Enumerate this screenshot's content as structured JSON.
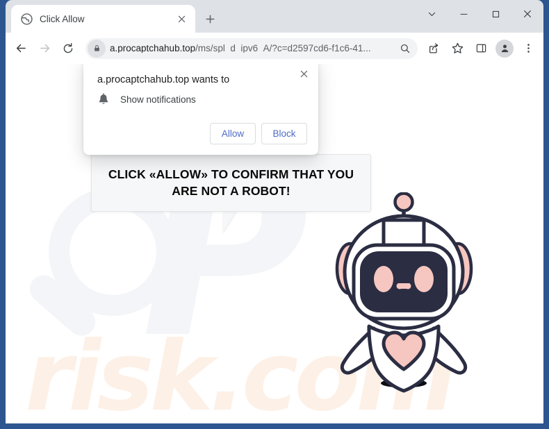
{
  "browser": {
    "tab": {
      "title": "Click Allow",
      "favicon_icon": "globe-icon",
      "close_icon": "close-icon"
    },
    "new_tab_icon": "plus-icon",
    "window_controls": [
      {
        "name": "tab-search",
        "icon": "chevron-down-icon"
      },
      {
        "name": "minimize",
        "icon": "minimize-icon"
      },
      {
        "name": "maximize",
        "icon": "maximize-icon"
      },
      {
        "name": "close",
        "icon": "close-icon"
      }
    ],
    "nav": {
      "back_icon": "arrow-left-icon",
      "forward_icon": "arrow-right-icon",
      "reload_icon": "reload-icon"
    },
    "omnibox": {
      "lock_icon": "lock-icon",
      "url_host": "a.procaptchahub.top",
      "url_path": "/ms/spl_d_ipv6_A/?c=d2597cd6-f1c6-41...",
      "search_icon": "search-icon"
    },
    "toolbar_icons": [
      {
        "name": "share-icon"
      },
      {
        "name": "bookmark-star-icon"
      },
      {
        "name": "side-panel-icon"
      },
      {
        "name": "profile-avatar"
      },
      {
        "name": "more-menu-icon"
      }
    ]
  },
  "permission_dialog": {
    "title": "a.procaptchahub.top wants to",
    "permission_icon": "bell-icon",
    "permission_label": "Show notifications",
    "allow_label": "Allow",
    "block_label": "Block",
    "close_icon": "close-icon"
  },
  "page": {
    "bubble_line1": "CLICK «ALLOW» TO CONFIRM THAT YOU",
    "bubble_line2": "ARE NOT A ROBOT!",
    "watermark_text": "risk.com",
    "mascot": "robot-mascot"
  },
  "colors": {
    "window_frame": "#2d5690",
    "tabstrip": "#dee1e6",
    "omnibox_bg": "#f1f3f4",
    "button_text": "#4d6bc6",
    "robot_outline": "#2b2d42",
    "robot_pink": "#f6c6c0",
    "watermark_peach": "#fdf0e6"
  }
}
